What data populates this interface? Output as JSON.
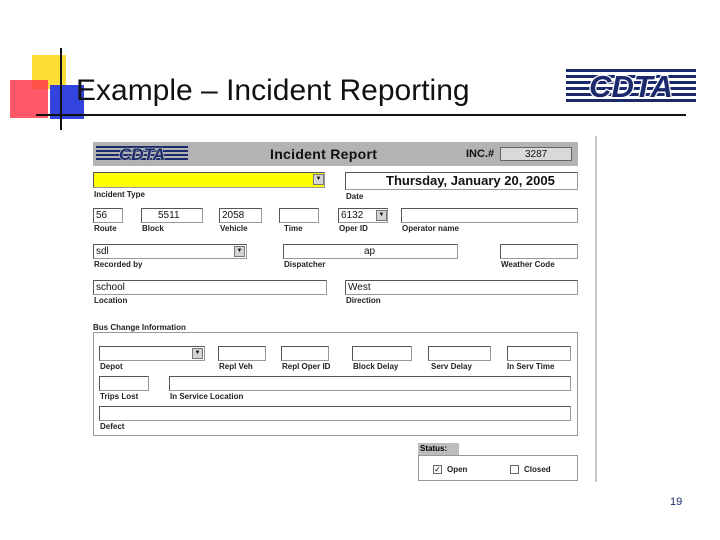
{
  "slide": {
    "title": "Example – Incident Reporting",
    "page_number": "19",
    "logo_text": "CDTA"
  },
  "form": {
    "header": {
      "logo_text": "CDTA",
      "title": "Incident Report",
      "inc_label": "INC.#",
      "inc_number": "3287"
    },
    "incident_type": {
      "label": "Incident Type",
      "value": ""
    },
    "date": {
      "label": "Date",
      "value": "Thursday, January 20, 2005"
    },
    "route": {
      "label": "Route",
      "value": "56"
    },
    "block": {
      "label": "Block",
      "value": "5511"
    },
    "vehicle": {
      "label": "Vehicle",
      "value": "2058"
    },
    "time": {
      "label": "Time",
      "value": ""
    },
    "oper_id": {
      "label": "Oper ID",
      "value": "6132"
    },
    "operator_name": {
      "label": "Operator name",
      "value": ""
    },
    "recorded_by": {
      "label": "Recorded by",
      "value": "sdl"
    },
    "dispatcher": {
      "label": "Dispatcher",
      "value": "ap"
    },
    "weather_code": {
      "label": "Weather Code",
      "value": ""
    },
    "location": {
      "label": "Location",
      "value": "school"
    },
    "direction": {
      "label": "Direction",
      "value": "West"
    },
    "bus_change": {
      "section_label": "Bus Change Information",
      "depot": {
        "label": "Depot",
        "value": ""
      },
      "repl_veh": {
        "label": "Repl Veh",
        "value": ""
      },
      "repl_oper_id": {
        "label": "Repl Oper ID",
        "value": ""
      },
      "block_delay": {
        "label": "Block Delay",
        "value": ""
      },
      "serv_delay": {
        "label": "Serv Delay",
        "value": ""
      },
      "in_serv_time": {
        "label": "In Serv Time",
        "value": ""
      },
      "trips_lost": {
        "label": "Trips Lost",
        "value": ""
      },
      "in_service_location": {
        "label": "In Service Location",
        "value": ""
      },
      "defect": {
        "label": "Defect",
        "value": ""
      }
    },
    "status": {
      "label": "Status:",
      "open_label": "Open",
      "open_checked": true,
      "closed_label": "Closed",
      "closed_checked": false
    }
  }
}
